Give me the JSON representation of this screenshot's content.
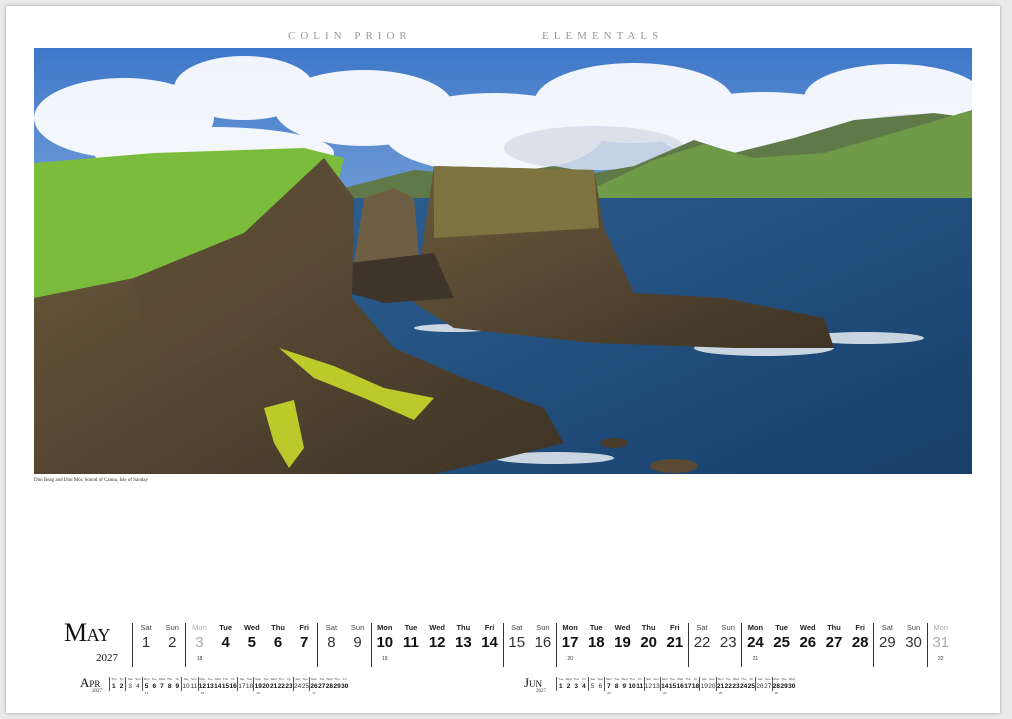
{
  "header": {
    "author": "COLIN PRIOR",
    "series": "ELEMENTALS"
  },
  "photo": {
    "subject": "sea-stacks-coastline"
  },
  "caption": "Dùn Beag and Dùn Mòr, Sound of Canna, Isle of Sanday",
  "main": {
    "month": "May",
    "year": "2027",
    "days": [
      {
        "n": "Sat",
        "d": "1",
        "t": "we",
        "wk": true
      },
      {
        "n": "Sun",
        "d": "2",
        "t": "we"
      },
      {
        "n": "Mon",
        "d": "3",
        "t": "other",
        "wk": true,
        "w": "18"
      },
      {
        "n": "Tue",
        "d": "4",
        "t": "wd"
      },
      {
        "n": "Wed",
        "d": "5",
        "t": "wd"
      },
      {
        "n": "Thu",
        "d": "6",
        "t": "wd"
      },
      {
        "n": "Fri",
        "d": "7",
        "t": "wd"
      },
      {
        "n": "Sat",
        "d": "8",
        "t": "we",
        "wk": true
      },
      {
        "n": "Sun",
        "d": "9",
        "t": "we"
      },
      {
        "n": "Mon",
        "d": "10",
        "t": "wd",
        "wk": true,
        "w": "19"
      },
      {
        "n": "Tue",
        "d": "11",
        "t": "wd"
      },
      {
        "n": "Wed",
        "d": "12",
        "t": "wd"
      },
      {
        "n": "Thu",
        "d": "13",
        "t": "wd"
      },
      {
        "n": "Fri",
        "d": "14",
        "t": "wd"
      },
      {
        "n": "Sat",
        "d": "15",
        "t": "we",
        "wk": true
      },
      {
        "n": "Sun",
        "d": "16",
        "t": "we"
      },
      {
        "n": "Mon",
        "d": "17",
        "t": "wd",
        "wk": true,
        "w": "20"
      },
      {
        "n": "Tue",
        "d": "18",
        "t": "wd"
      },
      {
        "n": "Wed",
        "d": "19",
        "t": "wd"
      },
      {
        "n": "Thu",
        "d": "20",
        "t": "wd"
      },
      {
        "n": "Fri",
        "d": "21",
        "t": "wd"
      },
      {
        "n": "Sat",
        "d": "22",
        "t": "we",
        "wk": true
      },
      {
        "n": "Sun",
        "d": "23",
        "t": "we"
      },
      {
        "n": "Mon",
        "d": "24",
        "t": "wd",
        "wk": true,
        "w": "21"
      },
      {
        "n": "Tue",
        "d": "25",
        "t": "wd"
      },
      {
        "n": "Wed",
        "d": "26",
        "t": "wd"
      },
      {
        "n": "Thu",
        "d": "27",
        "t": "wd"
      },
      {
        "n": "Fri",
        "d": "28",
        "t": "wd"
      },
      {
        "n": "Sat",
        "d": "29",
        "t": "we",
        "wk": true
      },
      {
        "n": "Sun",
        "d": "30",
        "t": "we"
      },
      {
        "n": "Mon",
        "d": "31",
        "t": "other",
        "wk": true,
        "w": "22"
      }
    ]
  },
  "prev": {
    "month": "Apr",
    "year": "2027",
    "days": [
      {
        "n": "Thu",
        "d": "1",
        "t": "wd",
        "wk": true
      },
      {
        "n": "Fri",
        "d": "2",
        "t": "wd"
      },
      {
        "n": "Sat",
        "d": "3",
        "t": "we",
        "wk": true
      },
      {
        "n": "Sun",
        "d": "4",
        "t": "we"
      },
      {
        "n": "Mon",
        "d": "5",
        "t": "wd",
        "wk": true,
        "w": "14"
      },
      {
        "n": "Tue",
        "d": "6",
        "t": "wd"
      },
      {
        "n": "Wed",
        "d": "7",
        "t": "wd"
      },
      {
        "n": "Thu",
        "d": "8",
        "t": "wd"
      },
      {
        "n": "Fri",
        "d": "9",
        "t": "wd"
      },
      {
        "n": "Sat",
        "d": "10",
        "t": "we",
        "wk": true
      },
      {
        "n": "Sun",
        "d": "11",
        "t": "we"
      },
      {
        "n": "Mon",
        "d": "12",
        "t": "wd",
        "wk": true,
        "w": "15"
      },
      {
        "n": "Tue",
        "d": "13",
        "t": "wd"
      },
      {
        "n": "Wed",
        "d": "14",
        "t": "wd"
      },
      {
        "n": "Thu",
        "d": "15",
        "t": "wd"
      },
      {
        "n": "Fri",
        "d": "16",
        "t": "wd"
      },
      {
        "n": "Sat",
        "d": "17",
        "t": "we",
        "wk": true
      },
      {
        "n": "Sun",
        "d": "18",
        "t": "we"
      },
      {
        "n": "Mon",
        "d": "19",
        "t": "wd",
        "wk": true,
        "w": "16"
      },
      {
        "n": "Tue",
        "d": "20",
        "t": "wd"
      },
      {
        "n": "Wed",
        "d": "21",
        "t": "wd"
      },
      {
        "n": "Thu",
        "d": "22",
        "t": "wd"
      },
      {
        "n": "Fri",
        "d": "23",
        "t": "wd"
      },
      {
        "n": "Sat",
        "d": "24",
        "t": "we",
        "wk": true
      },
      {
        "n": "Sun",
        "d": "25",
        "t": "we"
      },
      {
        "n": "Mon",
        "d": "26",
        "t": "wd",
        "wk": true,
        "w": "17"
      },
      {
        "n": "Tue",
        "d": "27",
        "t": "wd"
      },
      {
        "n": "Wed",
        "d": "28",
        "t": "wd"
      },
      {
        "n": "Thu",
        "d": "29",
        "t": "wd"
      },
      {
        "n": "Fri",
        "d": "30",
        "t": "wd"
      }
    ]
  },
  "next": {
    "month": "Jun",
    "year": "2027",
    "days": [
      {
        "n": "Tue",
        "d": "1",
        "t": "wd",
        "wk": true
      },
      {
        "n": "Wed",
        "d": "2",
        "t": "wd"
      },
      {
        "n": "Thu",
        "d": "3",
        "t": "wd"
      },
      {
        "n": "Fri",
        "d": "4",
        "t": "wd"
      },
      {
        "n": "Sat",
        "d": "5",
        "t": "we",
        "wk": true
      },
      {
        "n": "Sun",
        "d": "6",
        "t": "we"
      },
      {
        "n": "Mon",
        "d": "7",
        "t": "wd",
        "wk": true,
        "w": "23"
      },
      {
        "n": "Tue",
        "d": "8",
        "t": "wd"
      },
      {
        "n": "Wed",
        "d": "9",
        "t": "wd"
      },
      {
        "n": "Thu",
        "d": "10",
        "t": "wd"
      },
      {
        "n": "Fri",
        "d": "11",
        "t": "wd"
      },
      {
        "n": "Sat",
        "d": "12",
        "t": "we",
        "wk": true
      },
      {
        "n": "Sun",
        "d": "13",
        "t": "we"
      },
      {
        "n": "Mon",
        "d": "14",
        "t": "wd",
        "wk": true,
        "w": "24"
      },
      {
        "n": "Tue",
        "d": "15",
        "t": "wd"
      },
      {
        "n": "Wed",
        "d": "16",
        "t": "wd"
      },
      {
        "n": "Thu",
        "d": "17",
        "t": "wd"
      },
      {
        "n": "Fri",
        "d": "18",
        "t": "wd"
      },
      {
        "n": "Sat",
        "d": "19",
        "t": "we",
        "wk": true
      },
      {
        "n": "Sun",
        "d": "20",
        "t": "we"
      },
      {
        "n": "Mon",
        "d": "21",
        "t": "wd",
        "wk": true,
        "w": "25"
      },
      {
        "n": "Tue",
        "d": "22",
        "t": "wd"
      },
      {
        "n": "Wed",
        "d": "23",
        "t": "wd"
      },
      {
        "n": "Thu",
        "d": "24",
        "t": "wd"
      },
      {
        "n": "Fri",
        "d": "25",
        "t": "wd"
      },
      {
        "n": "Sat",
        "d": "26",
        "t": "we",
        "wk": true
      },
      {
        "n": "Sun",
        "d": "27",
        "t": "we"
      },
      {
        "n": "Mon",
        "d": "28",
        "t": "wd",
        "wk": true,
        "w": "26"
      },
      {
        "n": "Tue",
        "d": "29",
        "t": "wd"
      },
      {
        "n": "Wed",
        "d": "30",
        "t": "wd"
      }
    ]
  }
}
